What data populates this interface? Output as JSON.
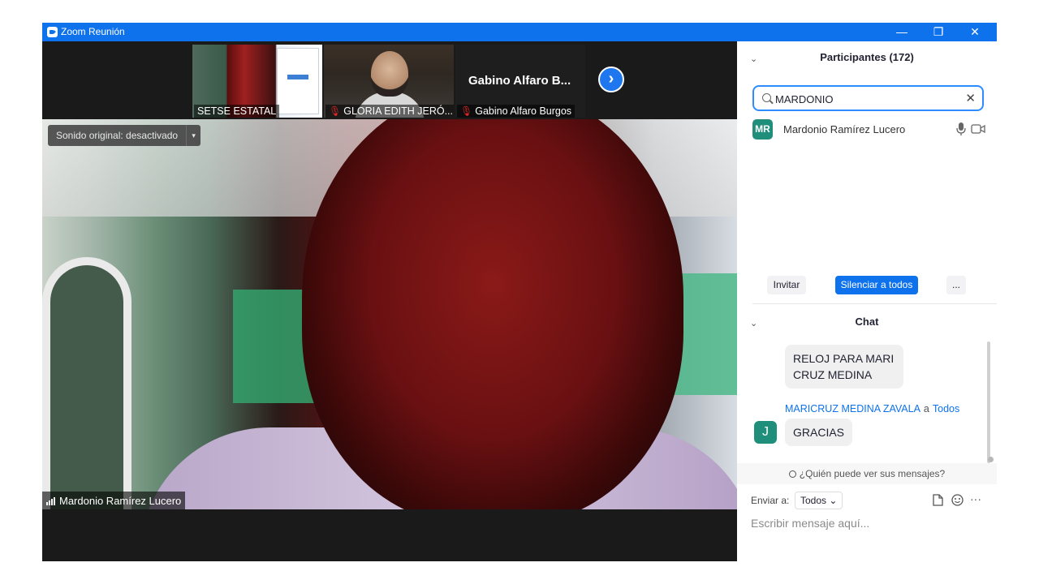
{
  "window": {
    "title": "Zoom Reunión",
    "controls": {
      "minimize": "—",
      "restore": "❐",
      "close": "✕"
    },
    "accent": "#0e72ed"
  },
  "thumbnails": [
    {
      "name": "SETSE ESTATAL",
      "muted": false
    },
    {
      "name": "GLORIA EDITH JERÓ...",
      "muted": true
    },
    {
      "name": "Gabino Alfaro Burgos",
      "muted": true,
      "big_label": "Gabino Alfaro B..."
    }
  ],
  "next_button": "›",
  "main_video": {
    "original_sound": "Sonido original: desactivado",
    "original_sound_caret": "▾",
    "speaker_name": "Mardonio Ramírez Lucero"
  },
  "participants": {
    "collapse": "⌄",
    "title": "Participantes (172)",
    "search_value": "MARDONIO",
    "clear": "✕",
    "items": [
      {
        "initials": "MR",
        "name": "Mardonio Ramírez Lucero",
        "avatar_color": "#1f8e7a"
      }
    ],
    "buttons": {
      "invite": "Invitar",
      "mute_all": "Silenciar a todos",
      "more": "..."
    }
  },
  "chat": {
    "collapse": "⌄",
    "title": "Chat",
    "messages": [
      {
        "text": "RELOJ PARA  MARI CRUZ MEDINA"
      },
      {
        "sender": "MARICRUZ MEDINA ZAVALA",
        "to_word": "a",
        "recipient": "Todos",
        "avatar": "J",
        "text": "GRACIAS"
      }
    ],
    "who_can_see": "¿Quién puede ver sus mensajes?",
    "send_to_label": "Enviar a:",
    "send_to_value": "Todos",
    "send_to_caret": "⌄",
    "tool_more": "···",
    "placeholder": "Escribir mensaje aquí..."
  }
}
